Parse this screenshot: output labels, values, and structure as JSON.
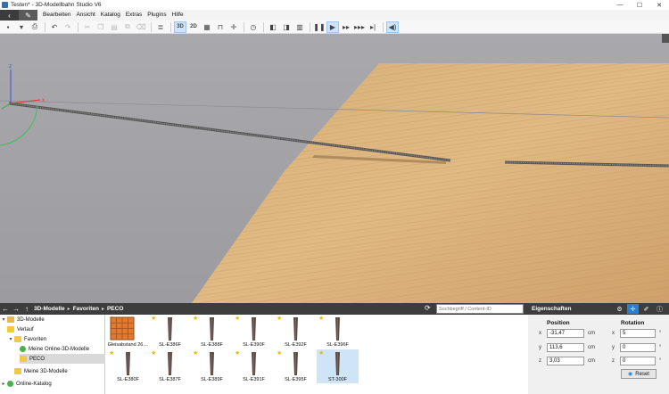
{
  "window": {
    "title": "Testen* - 3D-Modellbahn Studio V6",
    "minimize": "—",
    "maximize": "☐",
    "close": "✕"
  },
  "menu": {
    "items": [
      "Bearbeiten",
      "Ansicht",
      "Katalog",
      "Extras",
      "Plugins",
      "Hilfe"
    ]
  },
  "toolbar": {
    "view_3d": "3D",
    "view_2d": "2D"
  },
  "library": {
    "breadcrumb": [
      "3D-Modelle",
      "Favoriten",
      "PECO"
    ],
    "search_placeholder": "Suchbegriff / Content-ID",
    "tree": [
      {
        "label": "3D-Modelle",
        "expanded": true
      },
      {
        "label": "Verlauf"
      },
      {
        "label": "Favoriten",
        "expanded": true
      },
      {
        "label": "Meine Online-3D-Modelle"
      },
      {
        "label": "PECO",
        "selected": true
      },
      {
        "label": "Meine 3D-Modelle"
      },
      {
        "label": "Online-Katalog"
      }
    ],
    "items": [
      {
        "label": "Gleisabstand 26....",
        "kind": "gauge"
      },
      {
        "label": "SL-E386F",
        "kind": "track"
      },
      {
        "label": "SL-E388F",
        "kind": "track"
      },
      {
        "label": "SL-E390F",
        "kind": "track"
      },
      {
        "label": "SL-E392F",
        "kind": "track"
      },
      {
        "label": "SL-E396F",
        "kind": "track"
      },
      {
        "label": "SL-E380F",
        "kind": "track"
      },
      {
        "label": "SL-E387F",
        "kind": "track"
      },
      {
        "label": "SL-E389F",
        "kind": "track"
      },
      {
        "label": "SL-E391F",
        "kind": "track"
      },
      {
        "label": "SL-E395F",
        "kind": "track"
      },
      {
        "label": "ST-300F",
        "kind": "track",
        "selected": true
      }
    ]
  },
  "properties": {
    "title": "Eigenschaften",
    "position_heading": "Position",
    "rotation_heading": "Rotation",
    "position": [
      {
        "axis": "x",
        "value": "-31,47",
        "unit": "cm"
      },
      {
        "axis": "y",
        "value": "113,6",
        "unit": "cm"
      },
      {
        "axis": "z",
        "value": "3,03",
        "unit": "cm"
      }
    ],
    "rotation": [
      {
        "axis": "x",
        "value": "5",
        "unit": "°"
      },
      {
        "axis": "y",
        "value": "0",
        "unit": "°"
      },
      {
        "axis": "z",
        "value": "0",
        "unit": "°"
      }
    ],
    "reset_label": "Reset"
  }
}
